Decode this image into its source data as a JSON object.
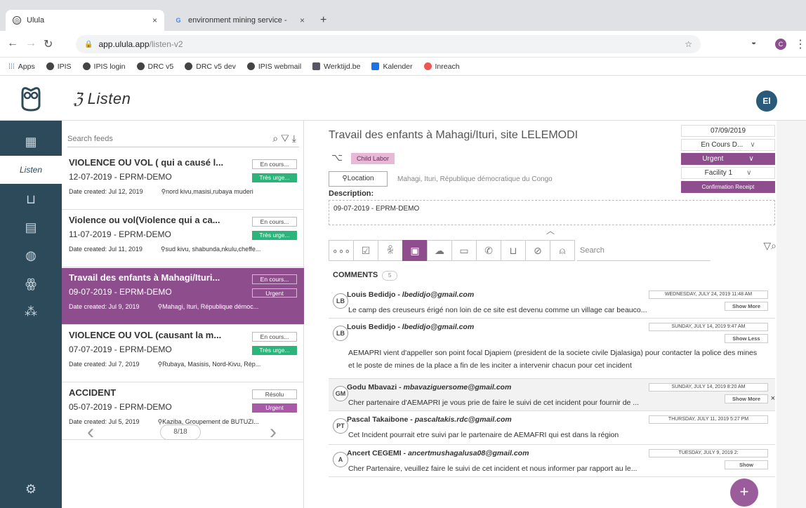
{
  "browser": {
    "tabs": [
      {
        "title": "Ulula"
      },
      {
        "title": "environment mining service - "
      }
    ],
    "url_host": "app.ulula.app",
    "url_path": "/listen-v2",
    "bookmarks": [
      "Apps",
      "IPIS",
      "IPIS login",
      "DRC v5",
      "DRC v5 dev",
      "IPIS webmail",
      "Werktijd.be",
      "Kalender",
      "Inreach"
    ],
    "user_initial": "C"
  },
  "app": {
    "title": "Listen",
    "user_initials": "El",
    "nav_active": "Listen"
  },
  "feed": {
    "search_placeholder": "Search feeds",
    "items": [
      {
        "title": "VIOLENCE OU VOL ( qui a causé l...",
        "sub": "12-07-2019 - EPRM-DEMO",
        "created": "Date created: Jul 12, 2019",
        "location": "nord kivu,masisi,rubaya muderi",
        "status": "En cours...",
        "priority": "Très urge...",
        "priority_color": "#2db47a"
      },
      {
        "title": "Violence ou vol(Violence qui a ca...",
        "sub": "11-07-2019 - EPRM-DEMO",
        "created": "Date created: Jul 11, 2019",
        "location": "sud kivu, shabunda,nkulu,cheffe...",
        "status": "En cours...",
        "priority": "Très urge...",
        "priority_color": "#2db47a"
      },
      {
        "title": "Travail des enfants à Mahagi/Ituri...",
        "sub": "09-07-2019 - EPRM-DEMO",
        "created": "Date created: Jul 9, 2019",
        "location": "Mahagi, Ituri, République démoc...",
        "status": "En cours...",
        "priority": "Urgent",
        "priority_color": "#8e4e8e"
      },
      {
        "title": "VIOLENCE OU VOL (causant la m...",
        "sub": "07-07-2019 - EPRM-DEMO",
        "created": "Date created: Jul 7, 2019",
        "location": "Rubaya, Masisis, Nord-Kivu, Rép...",
        "status": "En cours...",
        "priority": "Très urge...",
        "priority_color": "#2db47a"
      },
      {
        "title": "ACCIDENT",
        "sub": "05-07-2019 - EPRM-DEMO",
        "created": "Date created: Jul 5, 2019",
        "location": "Kaziba, Groupement de BUTUZI...",
        "status": "Résolu",
        "priority": "Urgent",
        "priority_color": "#a85aa8"
      }
    ],
    "page": "8/18"
  },
  "detail": {
    "title": "Travail des enfants à Mahagi/Ituri, site LELEMODI",
    "tag": "Child Labor",
    "location_btn": "Location",
    "location_text": "Mahagi, Ituri, République démocratique du Congo",
    "description_label": "Description:",
    "description": "09-07-2019 - EPRM-DEMO",
    "date": "07/09/2019",
    "status": "En Cours D...",
    "priority": "Urgent",
    "facility": "Facility 1",
    "receipt": "Confirmation Receipt",
    "search_placeholder": "Search",
    "comments_label": "COMMENTS",
    "comments_count": "5",
    "comments": [
      {
        "initials": "LB",
        "author": "Louis Bedidjo - ",
        "email": "lbedidjo@gmail.com",
        "date": "WEDNESDAY, JULY 24, 2019 11:48 AM",
        "more": "Show More",
        "text": "Le camp des creuseurs érigé non loin de ce site est devenu comme un village car beauco..."
      },
      {
        "initials": "LB",
        "author": "Louis Bedidjo - ",
        "email": "lbedidjo@gmail.com",
        "date": "SUNDAY, JULY 14, 2019 9:47 AM",
        "more": "Show Less",
        "text": "AEMAPRI vient d'appeller son point focal Djapiem (president de la societe civile Djalasiga) pour contacter la police des mines et le poste de mines de la place a fin de les inciter a intervenir chacun pour cet incident"
      },
      {
        "initials": "GM",
        "author": "Godu Mbavazi - ",
        "email": "mbavaziguersome@gmail.com",
        "date": "SUNDAY, JULY 14, 2019 8:20 AM",
        "more": "Show More",
        "text": "Cher partenaire d'AEMAPRI je vous prie de faire le suivi de cet incident pour fournir de ..."
      },
      {
        "initials": "PT",
        "author": "Pascal Takaibone - ",
        "email": "pascaltakis.rdc@gmail.com",
        "date": "THURSDAY, JULY 11, 2019 5:27 PM",
        "more": "",
        "text": "Cet Incident pourrait etre suivi par le partenaire de AEMAFRI qui est dans la région"
      },
      {
        "initials": "A",
        "author": "Ancert CEGEMI - ",
        "email": "ancertmushagalusa08@gmail.com",
        "date": "TUESDAY, JULY 9, 2019 2:",
        "more": "Show",
        "text": "Cher Partenaire, veuillez faire le suivi de cet incident et nous informer par rapport au le..."
      }
    ]
  }
}
